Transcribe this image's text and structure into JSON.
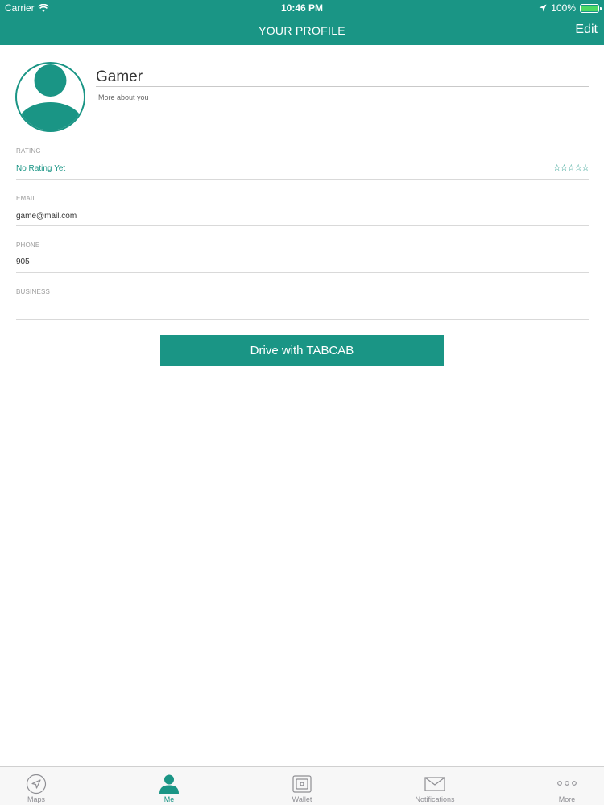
{
  "status_bar": {
    "carrier": "Carrier",
    "time": "10:46 PM",
    "battery": "100%"
  },
  "nav": {
    "title": "YOUR PROFILE",
    "edit_label": "Edit"
  },
  "profile": {
    "name": "Gamer",
    "about_placeholder": "More about you"
  },
  "fields": {
    "rating": {
      "label": "RATING",
      "value": "No Rating Yet",
      "stars": "☆☆☆☆☆"
    },
    "email": {
      "label": "EMAIL",
      "value": "game@mail.com"
    },
    "phone": {
      "label": "PHONE",
      "value": "905"
    },
    "business": {
      "label": "BUSINESS",
      "value": ""
    }
  },
  "drive_button": "Drive with TABCAB",
  "tabs": [
    {
      "label": "Maps",
      "icon": "navigation-arrow-icon"
    },
    {
      "label": "Me",
      "icon": "person-icon"
    },
    {
      "label": "Wallet",
      "icon": "wallet-icon"
    },
    {
      "label": "Notifications",
      "icon": "envelope-icon"
    },
    {
      "label": "More",
      "icon": "more-dots-icon"
    }
  ],
  "colors": {
    "accent": "#1a9585",
    "battery": "#4cd964"
  }
}
